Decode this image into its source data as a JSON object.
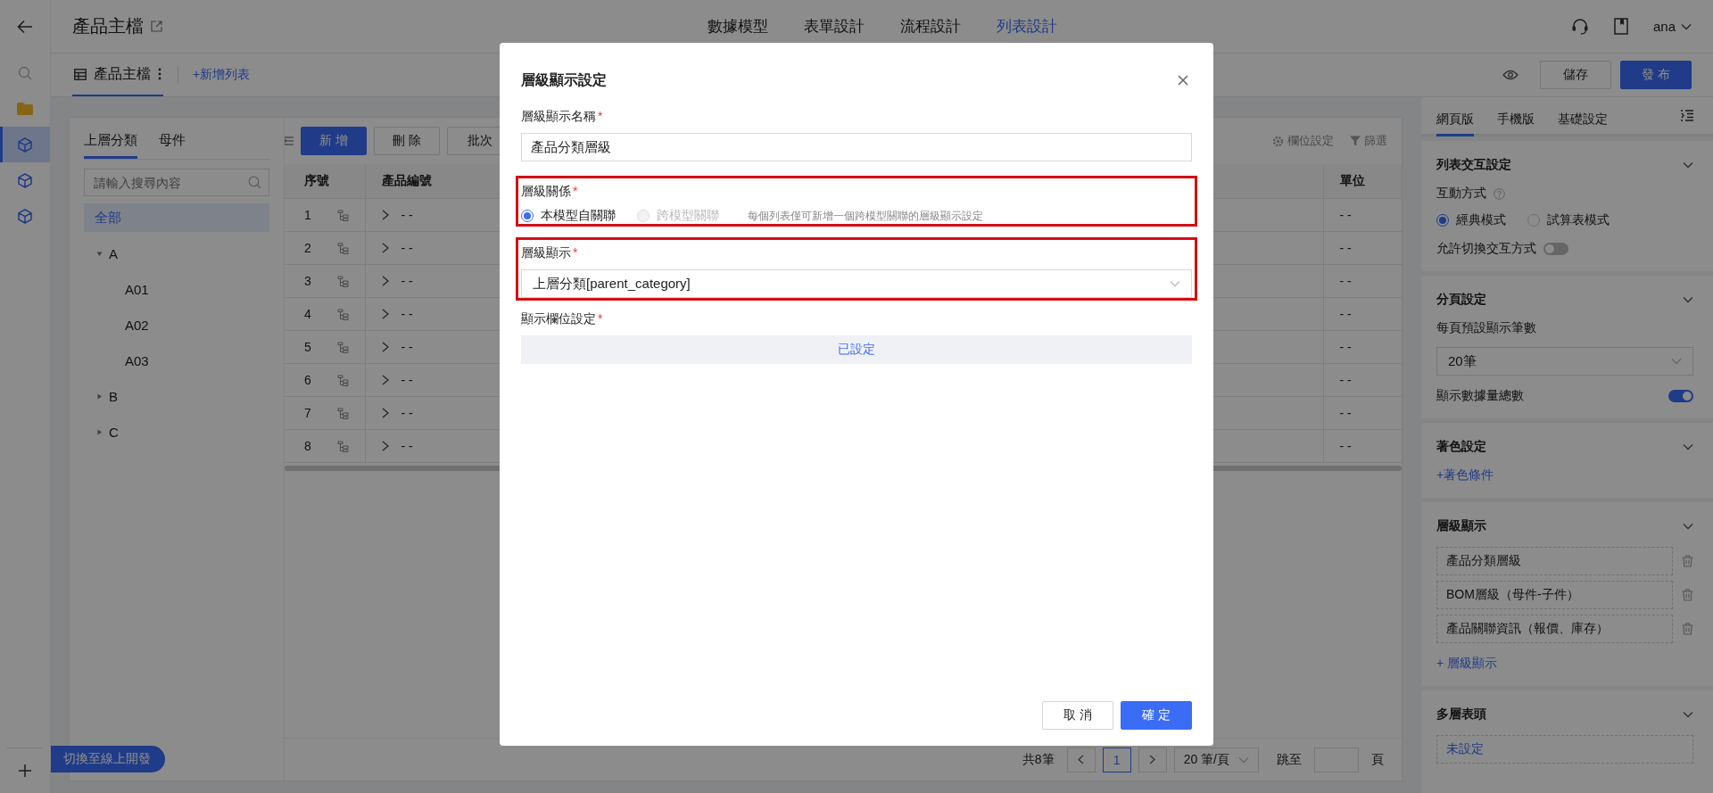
{
  "nav_rail": {
    "items": [
      {
        "kind": "back",
        "selected": false
      },
      {
        "kind": "search",
        "selected": false
      },
      {
        "kind": "folder",
        "selected": false
      },
      {
        "kind": "cube",
        "selected": true
      },
      {
        "kind": "cube",
        "selected": false
      },
      {
        "kind": "cube",
        "selected": false
      }
    ]
  },
  "switch_button": "切換至線上開發",
  "header": {
    "title": "產品主檔",
    "tabs": [
      {
        "label": "數據模型",
        "selected": false
      },
      {
        "label": "表單設計",
        "selected": false
      },
      {
        "label": "流程設計",
        "selected": false
      },
      {
        "label": "列表設計",
        "selected": true
      }
    ],
    "user": "ana"
  },
  "list_bar": {
    "tabs": [
      {
        "label": "產品主檔",
        "selected": true
      }
    ],
    "add_link": "+新增列表",
    "save_button": "儲存",
    "publish_button": "發 布"
  },
  "tree_panel": {
    "tabs": [
      {
        "label": "上層分類",
        "selected": true
      },
      {
        "label": "母件",
        "selected": false
      }
    ],
    "search": {
      "placeholder": "請輸入搜尋內容"
    },
    "items": [
      {
        "label": "全部",
        "selected": true
      },
      {
        "label": "A",
        "selected": false,
        "expanded": true,
        "children": [
          {
            "label": "A01",
            "selected": false
          },
          {
            "label": "A02",
            "selected": false
          },
          {
            "label": "A03",
            "selected": false
          }
        ]
      },
      {
        "label": "B",
        "selected": false,
        "expanded": false
      },
      {
        "label": "C",
        "selected": false,
        "expanded": false
      }
    ]
  },
  "toolbar": {
    "buttons": [
      {
        "label": "新 增",
        "kind": "primary"
      },
      {
        "label": "刪 除",
        "kind": "default"
      },
      {
        "label": "批次",
        "kind": "default"
      }
    ],
    "column_settings": "欄位設定",
    "filter": "篩選"
  },
  "table": {
    "columns": [
      "序號",
      "產品編號",
      "單位"
    ],
    "rows": [
      {
        "index": "1",
        "product_no": "- -",
        "unit": "- -"
      },
      {
        "index": "2",
        "product_no": "- -",
        "unit": "- -"
      },
      {
        "index": "3",
        "product_no": "- -",
        "unit": "- -"
      },
      {
        "index": "4",
        "product_no": "- -",
        "unit": "- -"
      },
      {
        "index": "5",
        "product_no": "- -",
        "unit": "- -"
      },
      {
        "index": "6",
        "product_no": "- -",
        "unit": "- -"
      },
      {
        "index": "7",
        "product_no": "- -",
        "unit": "- -"
      },
      {
        "index": "8",
        "product_no": "- -",
        "unit": "- -"
      }
    ]
  },
  "pagination": {
    "total": "共8筆",
    "page": "1",
    "page_size": "20 筆/頁",
    "jump_label": "跳至",
    "page_unit": "頁"
  },
  "settings_panel": {
    "tabs": [
      {
        "label": "網頁版",
        "selected": true
      },
      {
        "label": "手機版",
        "selected": false
      },
      {
        "label": "基礎設定",
        "selected": false
      }
    ],
    "sections": [
      {
        "title": "列表交互設定",
        "expanded": true,
        "items": [
          {
            "kind": "radio_group",
            "label": "互動方式",
            "help": true,
            "options": [
              {
                "label": "經典模式",
                "selected": true
              },
              {
                "label": "試算表模式",
                "selected": false
              }
            ]
          },
          {
            "kind": "switch",
            "label": "允許切換交互方式",
            "on": false
          }
        ]
      },
      {
        "title": "分頁設定",
        "expanded": true,
        "items": [
          {
            "kind": "select",
            "label": "每頁預設顯示筆數",
            "value": "20筆"
          },
          {
            "kind": "switch",
            "label": "顯示數據量總數",
            "on": true
          }
        ]
      },
      {
        "title": "著色設定",
        "expanded": true,
        "items": [
          {
            "kind": "link",
            "text": "+著色條件"
          }
        ]
      },
      {
        "title": "層級顯示",
        "expanded": true,
        "items": [
          {
            "kind": "list",
            "entries": [
              "產品分類層級",
              "BOM層級（母件-子件）",
              "產品關聯資訊（報價、庫存）"
            ]
          },
          {
            "kind": "link",
            "text": "+ 層級顯示"
          }
        ]
      },
      {
        "title": "多層表頭",
        "expanded": true,
        "items": [
          {
            "kind": "dashed_value",
            "text": "未設定"
          }
        ]
      }
    ]
  },
  "dialog": {
    "title": "層級顯示設定",
    "fields": [
      {
        "kind": "input",
        "label": "層級顯示名稱",
        "mark": "*",
        "highlighted": false,
        "value": "產品分類層級"
      },
      {
        "kind": "radio",
        "label": "層級關係",
        "mark": "*",
        "highlighted": true,
        "options": [
          {
            "label": "本模型自關聯",
            "selected": true,
            "disabled": false
          },
          {
            "label": "跨模型關聯",
            "selected": false,
            "disabled": true
          }
        ],
        "hint": "每個列表僅可新增一個跨模型關聯的層級顯示設定"
      },
      {
        "kind": "select",
        "label": "層級顯示",
        "mark": "*",
        "highlighted": true,
        "value": "上層分類[parent_category]"
      },
      {
        "kind": "button",
        "label": "顯示欄位設定",
        "mark": "*",
        "highlighted": false,
        "value": "已設定"
      }
    ],
    "buttons": [
      {
        "label": "取 消",
        "kind": "default"
      },
      {
        "label": "確 定",
        "kind": "primary"
      }
    ]
  }
}
